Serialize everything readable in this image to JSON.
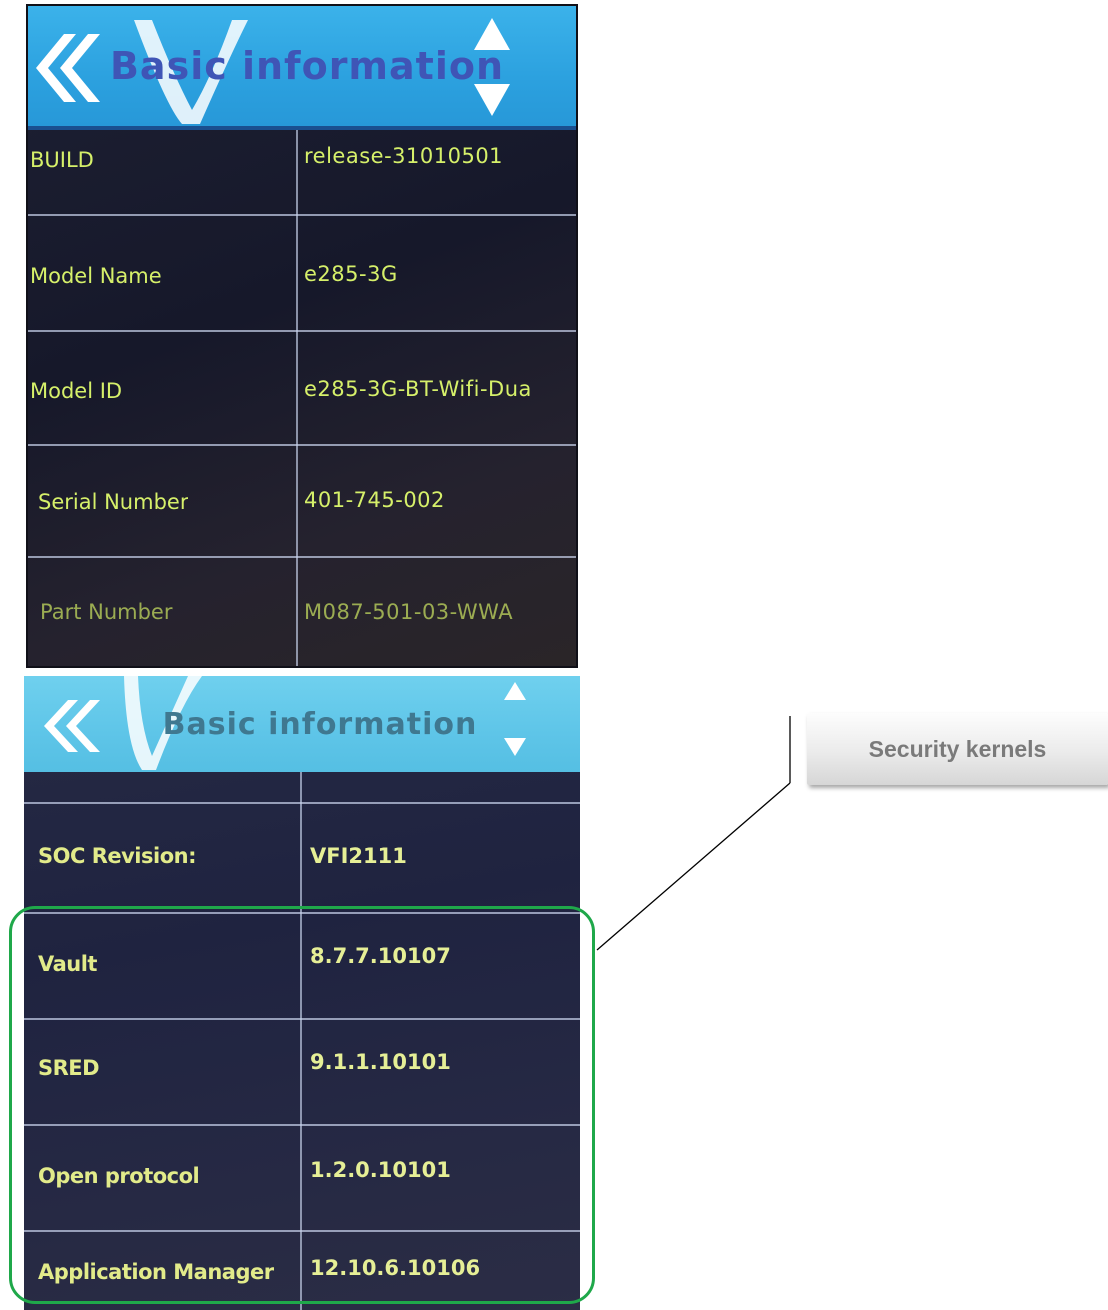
{
  "screen1": {
    "header": {
      "title": "Basic information"
    },
    "rows": [
      {
        "label": "BUILD",
        "value": "release-31010501"
      },
      {
        "label": "Model Name",
        "value": "e285-3G"
      },
      {
        "label": "Model ID",
        "value": "e285-3G-BT-Wifi-Dua"
      },
      {
        "label": "Serial Number",
        "value": "401-745-002"
      },
      {
        "label": "Part Number",
        "value": "M087-501-03-WWA"
      }
    ]
  },
  "screen2": {
    "header": {
      "title": "Basic information"
    },
    "rows": [
      {
        "label": "",
        "value": ""
      },
      {
        "label": "SOC Revision:",
        "value": "VFI2111"
      },
      {
        "label": "Vault",
        "value": "8.7.7.10107"
      },
      {
        "label": "SRED",
        "value": "9.1.1.10101"
      },
      {
        "label": "Open protocol",
        "value": "1.2.0.10101"
      },
      {
        "label": "Application Manager",
        "value": "12.10.6.10106"
      }
    ]
  },
  "annotation": {
    "callout_label": "Security kernels",
    "highlight_color": "#1fa84a"
  },
  "colors": {
    "header_blue": "#2ca1df",
    "header_title_blue": "#3f55b6",
    "value_text": "#d6f06a",
    "screen_bg": "#1d2033"
  }
}
